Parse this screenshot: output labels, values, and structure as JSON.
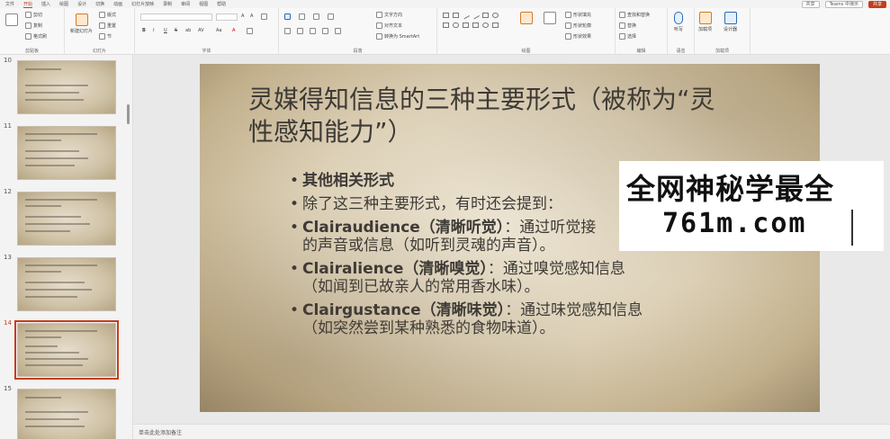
{
  "menubar": {
    "items": [
      "文件",
      "开始",
      "插入",
      "绘图",
      "设计",
      "切换",
      "动画",
      "幻灯片放映",
      "录制",
      "审阅",
      "视图",
      "帮助"
    ],
    "active_index": 1,
    "right": [
      "共享",
      "Teams 中演示",
      "共享"
    ]
  },
  "ribbon": {
    "groups": [
      "剪贴板",
      "幻灯片",
      "字体",
      "段落",
      "绘图",
      "编辑",
      "语音",
      "加载项"
    ],
    "clipboard": {
      "cut": "剪切",
      "copy": "复制",
      "format_painter": "格式刷"
    },
    "slides": {
      "new_slide": "新建幻灯片",
      "layout": "版式",
      "reset": "重置",
      "section": "节"
    },
    "editing": {
      "find": "查找和替换",
      "replace": "替换",
      "select": "选择"
    },
    "voice": {
      "dictate": "听写"
    },
    "addins": {
      "addins": "加载项",
      "designer": "设计器"
    },
    "paragraph": {
      "direction": "文字方向",
      "align": "对齐文本",
      "smartart": "转换为 SmartArt"
    },
    "drawing": {
      "fill": "形状填充",
      "outline": "形状轮廓",
      "effect": "形状效果"
    }
  },
  "thumbnails": {
    "numbers": [
      "10",
      "11",
      "12",
      "13",
      "14",
      "15"
    ],
    "selected_index": 4
  },
  "slide": {
    "title_line1": "灵媒得知信息的三种主要形式（被称为“灵",
    "title_line2": "性感知能力”）",
    "bullets": [
      {
        "bold": "其他相关形式",
        "rest": "",
        "sub": ""
      },
      {
        "bold": "",
        "rest": "除了这三种主要形式，有时还会提到：",
        "sub": ""
      },
      {
        "bold": "Clairaudience（清晰听觉）",
        "rest": "：通过听觉接",
        "sub": "的声音或信息（如听到灵魂的声音）。"
      },
      {
        "bold": "Clairalience（清晰嗅觉）",
        "rest": "：通过嗅觉感知信息",
        "sub": "（如闻到已故亲人的常用香水味）。"
      },
      {
        "bold": "Clairgustance（清晰味觉）",
        "rest": "：通过味觉感知信息",
        "sub": "（如突然尝到某种熟悉的食物味道）。"
      }
    ]
  },
  "watermark": {
    "line1": "全网神秘学最全",
    "line2": "761m.com"
  },
  "notes": {
    "placeholder": "单击此处添加备注"
  },
  "colors": {
    "accent": "#c43e1c"
  }
}
